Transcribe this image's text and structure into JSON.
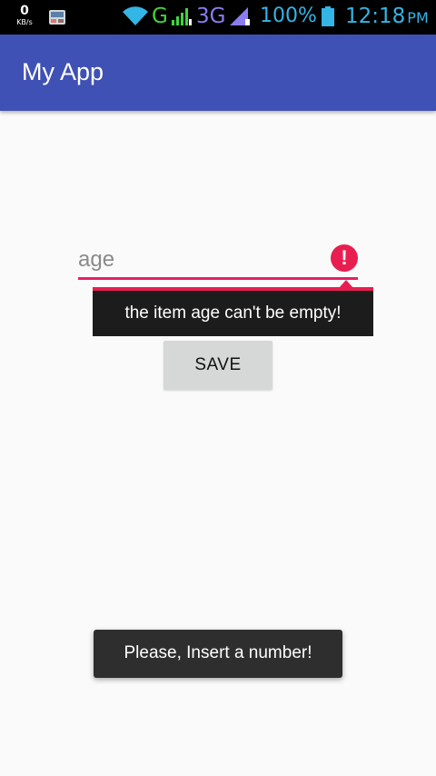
{
  "status_bar": {
    "net_speed_value": "0",
    "net_speed_unit": "KB/s",
    "network_type_1": "G",
    "network_type_2": "3G",
    "battery_percent": "100%",
    "time": "12:18",
    "ampm": "PM",
    "icons": [
      "app-notification-icon",
      "wifi-icon",
      "signal-icon",
      "battery-icon"
    ]
  },
  "app_bar": {
    "title": "My App",
    "color": "#3f51b5"
  },
  "form": {
    "age_placeholder": "age",
    "error_message": "the item age can't be empty!",
    "error_color": "#e91e50",
    "save_label": "SAVE"
  },
  "toast": {
    "message": "Please, Insert a number!"
  }
}
